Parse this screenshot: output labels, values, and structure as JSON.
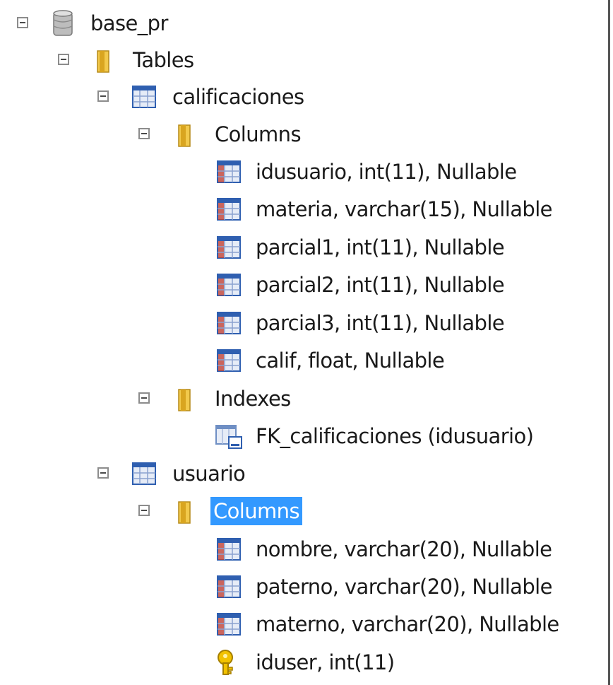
{
  "tree": {
    "database": {
      "label": "base_pr",
      "icon": "database-icon"
    },
    "tables_folder": {
      "label": "Tables",
      "icon": "folder-icon"
    },
    "table_calificaciones": {
      "label": "calificaciones",
      "icon": "table-icon",
      "columns_folder": {
        "label": "Columns",
        "icon": "folder-icon"
      },
      "columns": [
        {
          "label": "idusuario, int(11), Nullable",
          "icon": "column-icon"
        },
        {
          "label": "materia, varchar(15), Nullable",
          "icon": "column-icon"
        },
        {
          "label": "parcial1, int(11), Nullable",
          "icon": "column-icon"
        },
        {
          "label": "parcial2, int(11), Nullable",
          "icon": "column-icon"
        },
        {
          "label": "parcial3, int(11), Nullable",
          "icon": "column-icon"
        },
        {
          "label": "calif, float, Nullable",
          "icon": "column-icon"
        }
      ],
      "indexes_folder": {
        "label": "Indexes",
        "icon": "folder-icon"
      },
      "indexes": [
        {
          "label": "FK_calificaciones (idusuario)",
          "icon": "index-icon"
        }
      ]
    },
    "table_usuario": {
      "label": "usuario",
      "icon": "table-icon",
      "columns_folder": {
        "label": "Columns",
        "icon": "folder-icon",
        "selected": true
      },
      "columns": [
        {
          "label": "nombre, varchar(20), Nullable",
          "icon": "column-icon"
        },
        {
          "label": "paterno, varchar(20), Nullable",
          "icon": "column-icon"
        },
        {
          "label": "materno, varchar(20), Nullable",
          "icon": "column-icon"
        },
        {
          "label": "iduser, int(11)",
          "icon": "primary-key-icon"
        }
      ]
    }
  },
  "colors": {
    "selection": "#3399ff",
    "folder": "#e8b830",
    "table_header": "#2f5fb0",
    "column_red": "#c0392b",
    "key": "#e6b800"
  }
}
